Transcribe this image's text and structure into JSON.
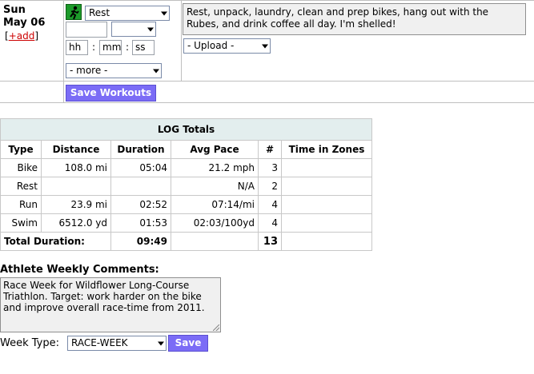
{
  "day": {
    "weekday": "Sun",
    "date": "May 06",
    "add_open": "[",
    "add_label": "+add",
    "add_close": "]"
  },
  "workout": {
    "activity_selected": "Rest",
    "time_hh": "hh",
    "time_mm": "mm",
    "time_ss": "ss",
    "time_sep": ":",
    "more_selected": "- more -",
    "save_label": "Save Workouts",
    "notes": "Rest, unpack, laundry, clean and prep bikes, hang out with the Rubes, and drink coffee all day. I'm shelled!",
    "upload_selected": "- Upload -"
  },
  "log_totals": {
    "title": "LOG Totals",
    "columns": [
      "Type",
      "Distance",
      "Duration",
      "Avg Pace",
      "#",
      "Time in Zones"
    ],
    "rows": [
      {
        "type": "Bike",
        "distance": "108.0 mi",
        "duration": "05:04",
        "pace": "21.2 mph",
        "count": "3",
        "zones": ""
      },
      {
        "type": "Rest",
        "distance": "",
        "duration": "",
        "pace": "N/A",
        "count": "2",
        "zones": ""
      },
      {
        "type": "Run",
        "distance": "23.9 mi",
        "duration": "02:52",
        "pace": "07:14/mi",
        "count": "4",
        "zones": ""
      },
      {
        "type": "Swim",
        "distance": "6512.0 yd",
        "duration": "01:53",
        "pace": "02:03/100yd",
        "count": "4",
        "zones": ""
      }
    ],
    "total_label": "Total Duration:",
    "total_duration": "09:49",
    "total_count": "13"
  },
  "comments": {
    "title": "Athlete Weekly Comments:",
    "text": "Race Week for Wildflower Long-Course Triathlon. Target: work harder on the bike and improve overall race-time from 2011."
  },
  "week_type": {
    "label": "Week Type:",
    "selected": "RACE-WEEK",
    "save_label": "Save"
  },
  "colors": {
    "button": "#7b6cf6",
    "table_header": "#e3eeee",
    "add_link": "#cc0000",
    "runner_icon": "#1c9a2a"
  }
}
